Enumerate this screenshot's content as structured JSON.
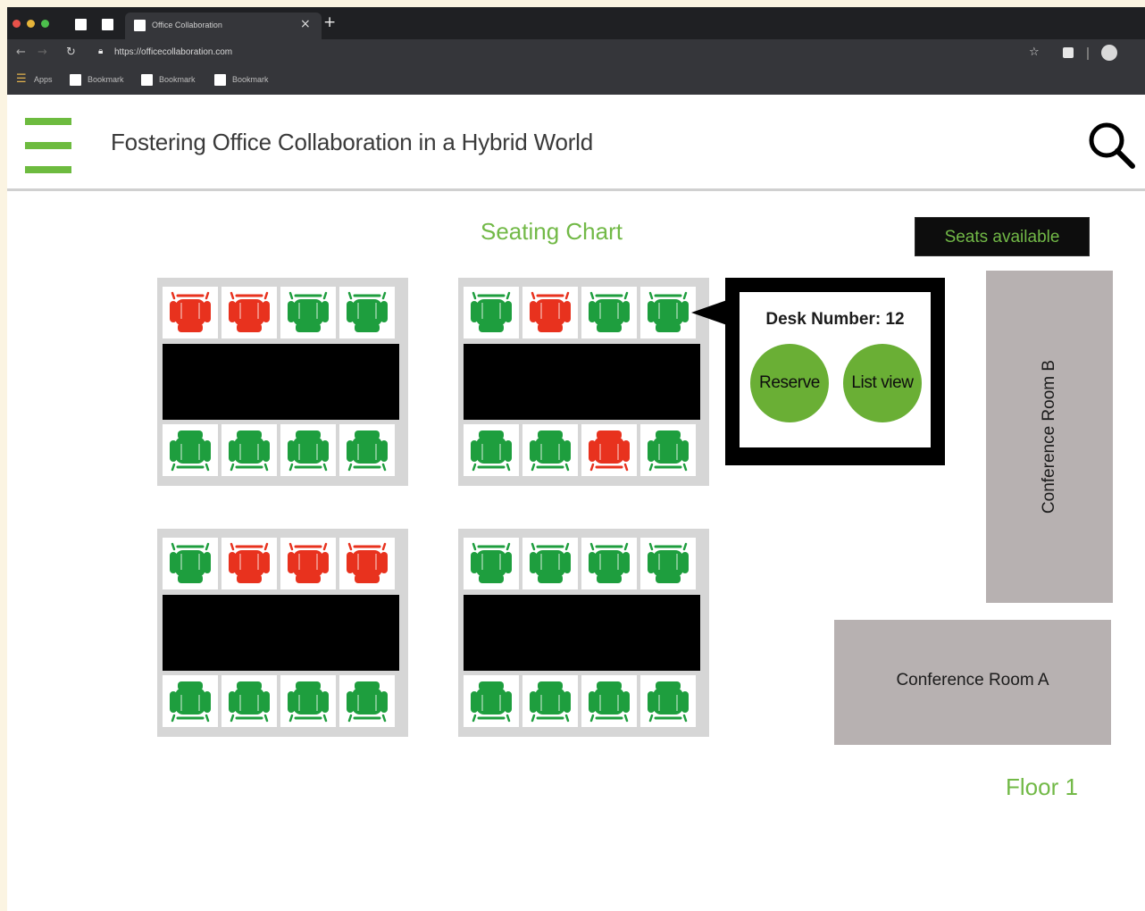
{
  "browser": {
    "tab_title": "Office Collaboration",
    "tab_close": "×",
    "new_tab": "+",
    "url": "https://officecollaboration.com",
    "bookmarks_apps": "Apps",
    "bookmarks": [
      "Bookmark",
      "Bookmark",
      "Bookmark"
    ]
  },
  "header": {
    "title": "Fostering Office Collaboration in a Hybrid World",
    "menu_icon": "hamburger-menu-icon",
    "search_icon": "search-icon"
  },
  "main": {
    "chart_title": "Seating Chart",
    "seats_badge": "Seats available",
    "floor": "Floor 1"
  },
  "seat_colors": {
    "available": "#1e9e3e",
    "reserved": "#e8321e"
  },
  "desks": [
    {
      "top": [
        "reserved",
        "reserved",
        "available",
        "available"
      ],
      "bottom": [
        "available",
        "available",
        "available",
        "available"
      ]
    },
    {
      "top": [
        "available",
        "reserved",
        "available",
        "available"
      ],
      "bottom": [
        "available",
        "available",
        "reserved",
        "available"
      ]
    },
    {
      "top": [
        "available",
        "reserved",
        "reserved",
        "reserved"
      ],
      "bottom": [
        "available",
        "available",
        "available",
        "available"
      ]
    },
    {
      "top": [
        "available",
        "available",
        "available",
        "available"
      ],
      "bottom": [
        "available",
        "available",
        "available",
        "available"
      ]
    }
  ],
  "popup": {
    "desk_number": "Desk Number: 12",
    "reserve_label": "Reserve",
    "list_view_label": "List view"
  },
  "rooms": {
    "room_b": "Conference Room B",
    "room_a": "Conference Room A"
  },
  "colors": {
    "brand_green": "#72b947",
    "table": "#000000",
    "room": "#b7b1b1"
  }
}
